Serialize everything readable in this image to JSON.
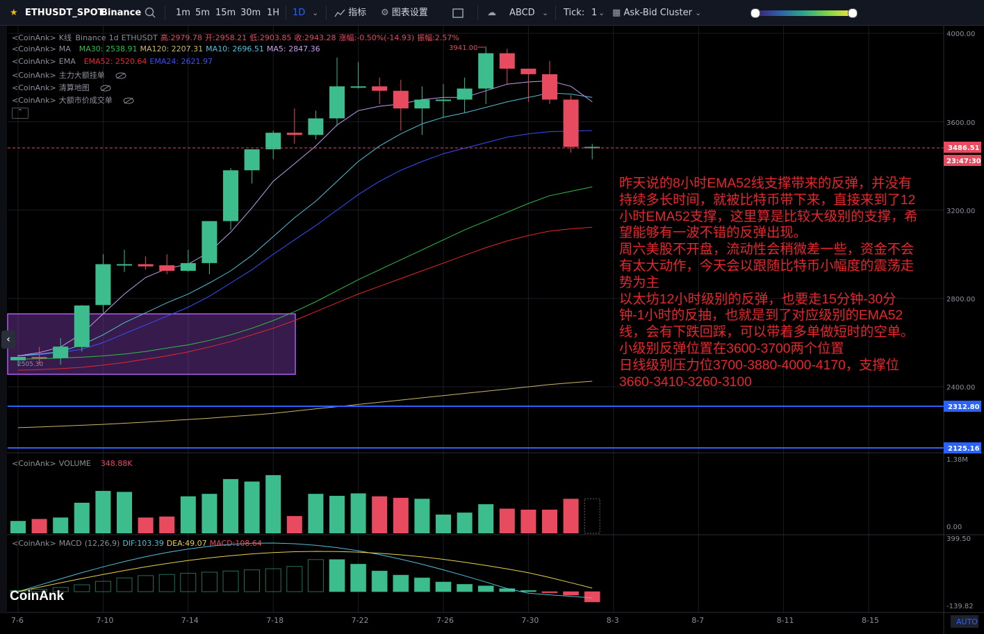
{
  "toolbar": {
    "symbol": "ETHUSDT_SPOT",
    "exchange": "Binance",
    "intervals": [
      "1m",
      "5m",
      "15m",
      "30m",
      "1H",
      "1D"
    ],
    "active_interval": "1D",
    "indicators_label": "指标",
    "chart_settings_label": "图表设置",
    "drawing_label": "ABCD",
    "tick_label": "Tick:",
    "tick_value": "1",
    "cluster_label": "Ask-Bid Cluster"
  },
  "legends": {
    "kline": {
      "prefix": "<CoinAnk>",
      "name": "K线",
      "exchange": "Binance",
      "interval": "1d",
      "symbol": "ETHUSDT",
      "high": "高:2979.78",
      "open": "开:2958.21",
      "low": "低:2903.85",
      "close": "收:2943.28",
      "change": "涨幅:-0.50%(-14.93)",
      "amplitude": "振幅:2.57%"
    },
    "ma": {
      "prefix": "<CoinAnk>",
      "name": "MA",
      "ma30": "MA30: 2538.91",
      "ma120": "MA120: 2207.31",
      "ma10": "MA10: 2696.51",
      "ma5": "MA5: 2847.36"
    },
    "ema": {
      "prefix": "<CoinAnk>",
      "name": "EMA",
      "ema52": "EMA52: 2520.64",
      "ema24": "EMA24: 2621.97"
    },
    "hidden": [
      {
        "prefix": "<CoinAnk>",
        "name": "主力大额挂单"
      },
      {
        "prefix": "<CoinAnk>",
        "name": "清算地图"
      },
      {
        "prefix": "<CoinAnk>",
        "name": "大额市价成交单"
      }
    ],
    "volume": {
      "prefix": "<CoinAnk>",
      "name": "VOLUME",
      "value": "348.88K"
    },
    "macd": {
      "prefix": "<CoinAnk>",
      "name": "MACD",
      "params": "(12,26,9)",
      "dif": "DIF:103.39",
      "dea": "DEA:49.07",
      "macd": "MACD:108.64"
    }
  },
  "price_axis": {
    "ticks": [
      "4000.00",
      "3600.00",
      "3200.00",
      "2800.00",
      "2400.00"
    ],
    "current_price": "3486.51",
    "countdown": "23:47:30",
    "line1": "2312.80",
    "line2": "2125.16"
  },
  "volume_axis": {
    "max": "1.38M",
    "zero": "0.00"
  },
  "macd_axis": {
    "max": "399.50",
    "min": "-139.82"
  },
  "time_axis": {
    "labels": [
      "7-6",
      "7-10",
      "7-14",
      "7-18",
      "7-22",
      "7-26",
      "7-30",
      "8-3",
      "8-7",
      "8-11",
      "8-15"
    ],
    "auto": "AUTO"
  },
  "chart_labels": {
    "high_marker": "3941.00",
    "low_marker": "2505.30"
  },
  "annotation": [
    "昨天说的8小时EMA52线支撑带来的反弹，并没有",
    "持续多长时间，就被比特币带下来，直接来到了12",
    "小时EMA52支撑，这里算是比较大级别的支撑，希",
    "望能够有一波不错的反弹出现。",
    "周六美股不开盘，流动性会稍微差一些，资金不会",
    "有太大动作，今天会以跟随比特币小幅度的震荡走",
    "势为主",
    "以太坊12小时级别的反弹，也要走15分钟-30分",
    "钟-1小时的反抽，也就是到了对应级别的EMA52",
    "线，会有下跌回踩，可以带着多单做短时的空单。",
    "小级别反弹位置在3600-3700两个位置",
    "日线级别压力位3700-3880-4000-4170，支撑位",
    "3660-3410-3260-3100"
  ],
  "logo": "CoinAnk",
  "colors": {
    "up": "#3dbd8e",
    "down": "#e84a5f",
    "ma5": "#c79ef0",
    "ma10": "#52c0d6",
    "ma30": "#2fbf4a",
    "ma120": "#c9b86a",
    "ema52": "#e8262c",
    "ema24": "#3a4fff",
    "annotation": "#e8262c",
    "accent": "#2962ff"
  },
  "chart_data": {
    "type": "candlestick",
    "dates": [
      "7-6",
      "7-7",
      "7-8",
      "7-9",
      "7-10",
      "7-11",
      "7-12",
      "7-13",
      "7-14",
      "7-15",
      "7-16",
      "7-17",
      "7-18",
      "7-19",
      "7-20",
      "7-21",
      "7-22",
      "7-23",
      "7-24",
      "7-25",
      "7-26",
      "7-27",
      "7-28",
      "7-29",
      "7-30",
      "7-31",
      "8-1",
      "8-2"
    ],
    "open": [
      2520,
      2535,
      2530,
      2580,
      2770,
      2955,
      2955,
      2950,
      2925,
      2960,
      3150,
      3380,
      3475,
      3550,
      3540,
      3615,
      3760,
      3760,
      3740,
      3660,
      3700,
      3700,
      3750,
      3910,
      3840,
      3815,
      3700,
      3486
    ],
    "high": [
      2545,
      2580,
      2620,
      2770,
      3000,
      3020,
      2990,
      3000,
      3020,
      3080,
      3390,
      3450,
      3560,
      3660,
      3650,
      3890,
      3870,
      3800,
      3790,
      3760,
      3770,
      3800,
      3941,
      3930,
      3830,
      3875,
      3720,
      3500
    ],
    "low": [
      2495,
      2505,
      2500,
      2560,
      2735,
      2920,
      2930,
      2910,
      2920,
      2910,
      3110,
      3320,
      3430,
      3500,
      3520,
      3580,
      3750,
      3680,
      3560,
      3540,
      3620,
      3640,
      3680,
      3770,
      3690,
      3680,
      3460,
      3430
    ],
    "close": [
      2535,
      2530,
      2582,
      2768,
      2955,
      2955,
      2945,
      2925,
      2960,
      3150,
      3380,
      3475,
      3550,
      3540,
      3615,
      3760,
      3760,
      3740,
      3660,
      3700,
      3700,
      3750,
      3910,
      3840,
      3815,
      3700,
      3486,
      3486
    ],
    "volume": [
      0.25,
      0.29,
      0.32,
      0.62,
      0.86,
      0.84,
      0.32,
      0.34,
      0.75,
      0.8,
      1.1,
      1.05,
      1.18,
      0.35,
      0.8,
      0.76,
      0.81,
      0.75,
      0.72,
      0.7,
      0.38,
      0.42,
      0.59,
      0.5,
      0.48,
      0.48,
      0.7,
      0.7
    ],
    "macd_hist": [
      5,
      10,
      18,
      30,
      45,
      60,
      70,
      75,
      80,
      85,
      90,
      95,
      100,
      110,
      140,
      140,
      120,
      90,
      72,
      60,
      42,
      32,
      25,
      13,
      5,
      -5,
      -15,
      -45,
      -85
    ],
    "ma5": [
      2540,
      2555,
      2580,
      2640,
      2730,
      2820,
      2895,
      2935,
      2955,
      3010,
      3100,
      3210,
      3330,
      3410,
      3490,
      3585,
      3650,
      3670,
      3680,
      3700,
      3710,
      3710,
      3740,
      3770,
      3780,
      3785,
      3760,
      3690
    ],
    "ma10": [
      2540,
      2548,
      2560,
      2590,
      2635,
      2690,
      2735,
      2780,
      2820,
      2870,
      2925,
      2995,
      3080,
      3165,
      3240,
      3330,
      3420,
      3490,
      3545,
      3590,
      3620,
      3640,
      3665,
      3690,
      3710,
      3730,
      3725,
      3710
    ],
    "ma30": [
      2525,
      2527,
      2530,
      2534,
      2540,
      2548,
      2560,
      2575,
      2590,
      2610,
      2635,
      2665,
      2700,
      2740,
      2785,
      2835,
      2885,
      2930,
      2975,
      3020,
      3065,
      3110,
      3150,
      3190,
      3230,
      3265,
      3285,
      3305
    ],
    "ma120": [
      2215,
      2218,
      2222,
      2226,
      2230,
      2235,
      2240,
      2246,
      2252,
      2258,
      2265,
      2272,
      2280,
      2290,
      2300,
      2310,
      2320,
      2330,
      2340,
      2350,
      2360,
      2370,
      2380,
      2390,
      2400,
      2410,
      2418,
      2425
    ],
    "ema24": [
      2540,
      2545,
      2555,
      2570,
      2600,
      2640,
      2680,
      2720,
      2760,
      2810,
      2870,
      2930,
      3000,
      3065,
      3130,
      3200,
      3270,
      3330,
      3380,
      3420,
      3455,
      3480,
      3505,
      3530,
      3545,
      3555,
      3558,
      3560
    ],
    "ema52": [
      2475,
      2478,
      2482,
      2488,
      2498,
      2510,
      2525,
      2540,
      2558,
      2580,
      2605,
      2635,
      2665,
      2700,
      2740,
      2780,
      2820,
      2855,
      2890,
      2925,
      2960,
      2995,
      3030,
      3060,
      3085,
      3105,
      3115,
      3122
    ],
    "ylim": [
      2100,
      4000
    ],
    "horizontal_lines": [
      3486.51,
      2312.8,
      2125.16
    ]
  }
}
